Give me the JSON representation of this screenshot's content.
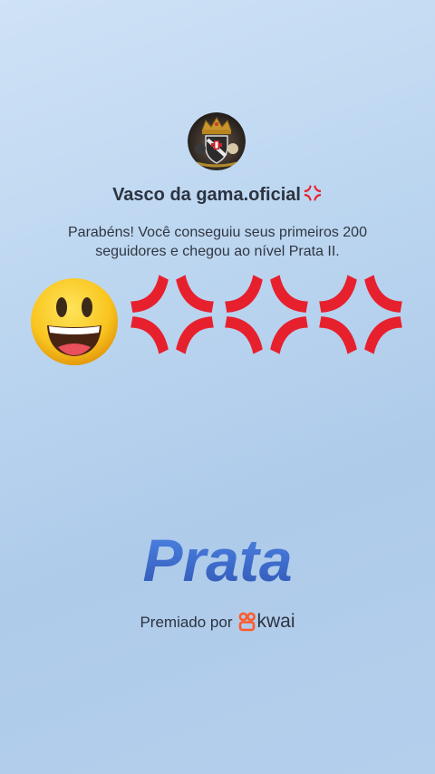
{
  "profile": {
    "username": "Vasco da gama.oficial",
    "username_suffix_icon": "anger-symbol-icon",
    "avatar_icon": "club-crest-avatar"
  },
  "message": {
    "text": "Parabéns! Você conseguiu seus primeiros 200 seguidores e chegou ao nível Prata II."
  },
  "emojis": [
    "grinning-face-emoji",
    "anger-symbol-emoji",
    "anger-symbol-emoji",
    "anger-symbol-emoji"
  ],
  "tier": {
    "label": "Prata",
    "color": "#3f6fd0"
  },
  "footer": {
    "awarded_by": "Premiado por",
    "brand": "kwai",
    "brand_color": "#ff5a2c"
  },
  "colors": {
    "anger_red": "#e7202e",
    "text_dark": "#2c3340"
  }
}
